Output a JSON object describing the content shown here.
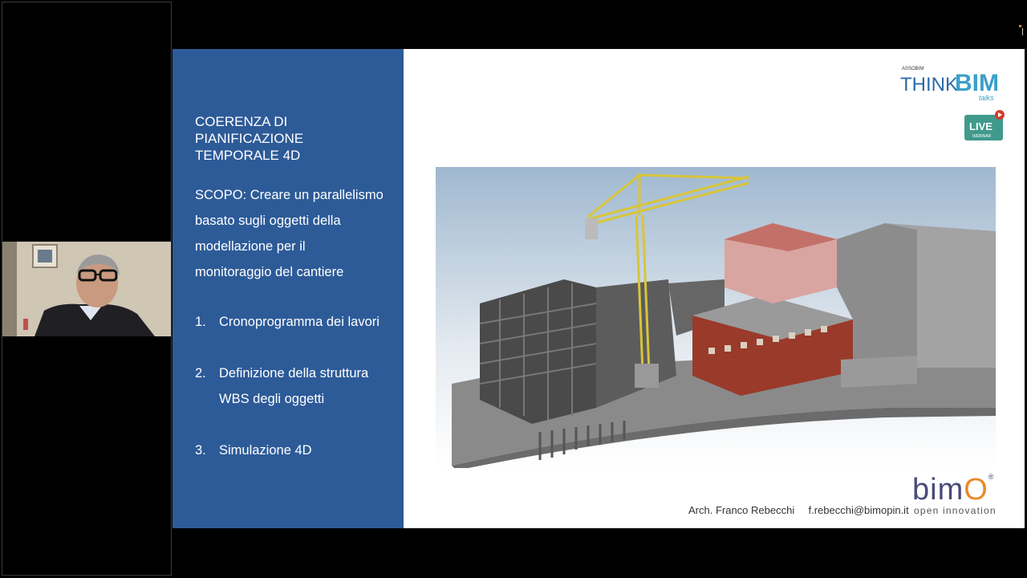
{
  "slide": {
    "title_lines": [
      "COERENZA DI",
      "PIANIFICAZIONE",
      "TEMPORALE 4D"
    ],
    "scope_lines": [
      "SCOPO: Creare un parallelismo",
      "basato sugli oggetti della",
      "modellazione per il",
      "monitoraggio del cantiere"
    ],
    "list": [
      {
        "num": "1.",
        "lines": [
          "Cronoprogramma dei lavori"
        ]
      },
      {
        "num": "2.",
        "lines": [
          "Definizione della struttura",
          "WBS degli oggetti"
        ]
      },
      {
        "num": "3.",
        "lines": [
          "Simulazione 4D"
        ]
      }
    ],
    "footer_name": "Arch. Franco Rebecchi",
    "footer_email": "f.rebecchi@bimopin.it"
  },
  "logos": {
    "assobim": "ASSOBIM",
    "think": "THINK",
    "bim": "BIM",
    "talks": "talks",
    "live": "LIVE",
    "webinar": "WEBINAR",
    "bimo_word": "bim",
    "bimo_o": "O",
    "bimo_reg": "®",
    "bimo_sub": "open innovation"
  },
  "colors": {
    "slide_blue": "#2d5b98",
    "think_blue": "#2c6aa8",
    "bim_teal": "#3aa0c8",
    "live_green": "#3f9a8c",
    "live_red": "#d83a2a",
    "bimo_orange": "#e98a2a"
  }
}
